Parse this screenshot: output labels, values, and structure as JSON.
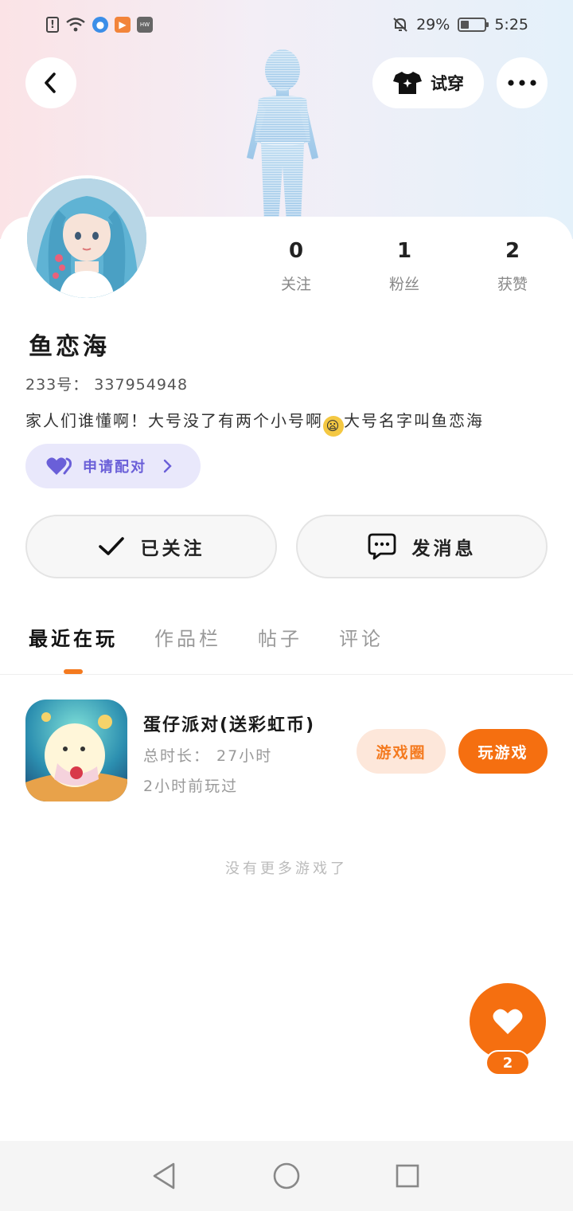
{
  "status_bar": {
    "battery_text": "29%",
    "battery_level": 0.29,
    "time": "5:25",
    "left_icons": [
      "alert-icon",
      "wifi-icon",
      "app-notification-icon",
      "video-app-icon",
      "huawei-store-icon"
    ],
    "right_icons": [
      "mute-bell-icon",
      "battery-icon"
    ]
  },
  "header": {
    "back_icon": "chevron-left-icon",
    "try_on_label": "试穿",
    "try_on_icon": "tshirt-sparkle-icon",
    "more_icon": "more-dots-icon"
  },
  "profile": {
    "name": "鱼恋海",
    "id_line": "233号：  337954948",
    "bio_before": "家人们谁懂啊！大号没了有两个小号啊",
    "bio_after": "大号名字叫鱼恋海",
    "pair_label": "申请配对",
    "stats": [
      {
        "value": "0",
        "label": "关注"
      },
      {
        "value": "1",
        "label": "粉丝"
      },
      {
        "value": "2",
        "label": "获赞"
      }
    ],
    "follow_label": "已关注",
    "message_label": "发消息"
  },
  "tabs": [
    {
      "label": "最近在玩",
      "active": true
    },
    {
      "label": "作品栏",
      "active": false
    },
    {
      "label": "帖子",
      "active": false
    },
    {
      "label": "评论",
      "active": false
    }
  ],
  "game": {
    "title": "蛋仔派对(送彩虹币)",
    "total_time": "总时长：  27小时",
    "last_played": "2小时前玩过",
    "circle_label": "游戏圈",
    "play_label": "玩游戏"
  },
  "no_more_text": "没有更多游戏了",
  "fab": {
    "icon": "heart-icon",
    "count": "2"
  },
  "nav": [
    "back-nav-icon",
    "home-nav-icon",
    "recents-nav-icon"
  ],
  "colors": {
    "accent": "#f56f10",
    "accent_light": "#fde7da",
    "pair_purple": "#6a5fd8",
    "pair_bg": "#e9e8fb"
  }
}
